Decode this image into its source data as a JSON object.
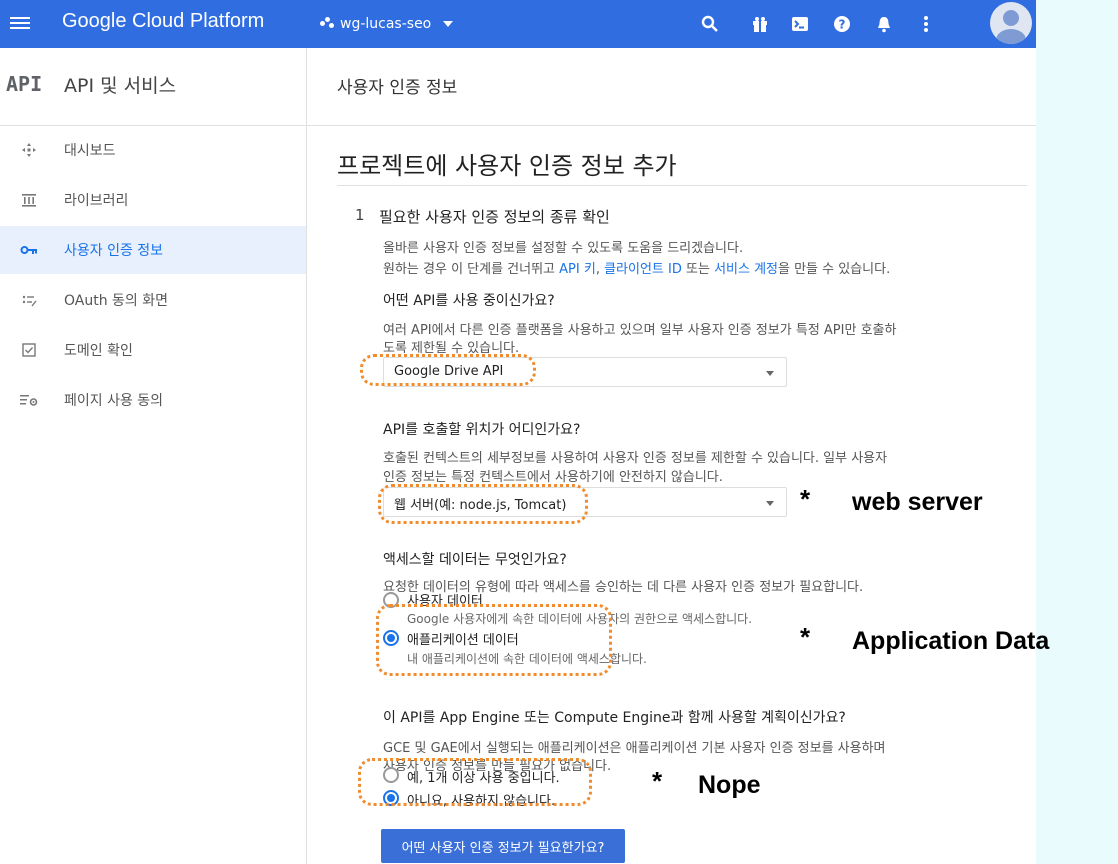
{
  "topbar": {
    "brand": "Google Cloud Platform",
    "project": "wg-lucas-seo",
    "icons": [
      "menu-icon",
      "search-icon",
      "gift-icon",
      "terminal-icon",
      "help-icon",
      "bell-icon",
      "more-vert-icon",
      "account-icon"
    ],
    "color": "#2f6de1"
  },
  "subheader": {
    "logo": "API",
    "title": "API 및 서비스",
    "page": "사용자 인증 정보"
  },
  "sidebar": {
    "items": [
      {
        "label": "대시보드",
        "icon": "dashboard-icon"
      },
      {
        "label": "라이브러리",
        "icon": "library-icon"
      },
      {
        "label": "사용자 인증 정보",
        "icon": "key-icon",
        "active": true
      },
      {
        "label": "OAuth 동의 화면",
        "icon": "oauth-icon"
      },
      {
        "label": "도메인 확인",
        "icon": "checkbox-icon"
      },
      {
        "label": "페이지 사용 동의",
        "icon": "settings-list-icon"
      }
    ]
  },
  "main": {
    "heading": "프로젝트에 사용자 인증 정보 추가",
    "step_number": "1",
    "step_title": "필요한 사용자 인증 정보의 종류 확인",
    "intro_line1": "올바른 사용자 인증 정보를 설정할 수 있도록 도움을 드리겠습니다.",
    "intro_line2_prefix": "원하는 경우 이 단계를 건너뛰고 ",
    "intro_link1": "API 키",
    "intro_comma": ", ",
    "intro_link2": "클라이언트 ID",
    "intro_mid": " 또는 ",
    "intro_link3": "서비스 계정",
    "intro_suffix": "을 만들 수 있습니다.",
    "q1": "어떤 API를 사용 중이신가요?",
    "q1_desc1": "여러 API에서 다른 인증 플랫폼을 사용하고 있으며 일부 사용자 인증 정보가 특정 API만 호출하",
    "q1_desc2": "도록 제한될 수 있습니다.",
    "q1_value": "Google Drive API",
    "q2": "API를 호출할 위치가 어디인가요?",
    "q2_desc1": "호출된 컨텍스트의 세부정보를 사용하여 사용자 인증 정보를 제한할 수 있습니다. 일부 사용자",
    "q2_desc2": "인증 정보는 특정 컨텍스트에서 사용하기에 안전하지 않습니다.",
    "q2_value": "웹 서버(예: node.js, Tomcat)",
    "q3": "액세스할 데이터는 무엇인가요?",
    "q3_desc": "요청한 데이터의 유형에 따라 액세스를 승인하는 데 다른 사용자 인증 정보가 필요합니다.",
    "q3_opt1": "사용자 데이터",
    "q3_opt1_desc": "Google 사용자에게 속한 데이터에 사용자의 권한으로 액세스합니다.",
    "q3_opt2": "애플리케이션 데이터",
    "q3_opt2_desc": "내 애플리케이션에 속한 데이터에 액세스합니다.",
    "q3_selected": 2,
    "q4": "이 API를 App Engine 또는 Compute Engine과 함께 사용할 계획이신가요?",
    "q4_desc1": "GCE 및 GAE에서 실행되는 애플리케이션은 애플리케이션 기본 사용자 인증 정보를 사용하며",
    "q4_desc2": "사용자 인증 정보를 만들 필요가 없습니다.",
    "q4_opt1": "예, 1개 이상 사용 중입니다.",
    "q4_opt2": "아니요, 사용하지 않습니다.",
    "q4_selected": 2,
    "submit": "어떤 사용자 인증 정보가 필요한가요?"
  },
  "annotations": {
    "star": "*",
    "note1": "web server",
    "note2": "Application Data",
    "note3": "Nope",
    "highlight_color": "#f08c2e"
  }
}
